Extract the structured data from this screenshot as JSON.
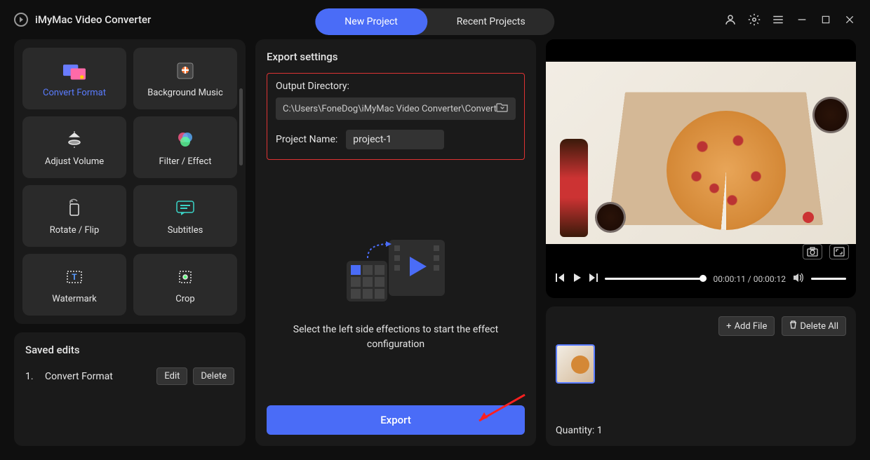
{
  "app": {
    "title": "iMyMac Video Converter"
  },
  "tabs": {
    "new_project": "New Project",
    "recent_projects": "Recent Projects"
  },
  "tools": {
    "convert_format": "Convert Format",
    "background_music": "Background Music",
    "adjust_volume": "Adjust Volume",
    "filter_effect": "Filter / Effect",
    "rotate_flip": "Rotate / Flip",
    "subtitles": "Subtitles",
    "watermark": "Watermark",
    "crop": "Crop"
  },
  "saved_edits": {
    "title": "Saved edits",
    "items": [
      {
        "index": "1.",
        "name": "Convert Format"
      }
    ],
    "edit_label": "Edit",
    "delete_label": "Delete"
  },
  "export": {
    "title": "Export settings",
    "output_dir_label": "Output Directory:",
    "output_dir_value": "C:\\Users\\FoneDog\\iMyMac Video Converter\\Converted",
    "project_name_label": "Project Name:",
    "project_name_value": "project-1",
    "helper_text": "Select the left side effections to start the effect configuration",
    "export_button": "Export"
  },
  "player": {
    "time_current": "00:00:11",
    "time_total": "00:00:12",
    "time_sep": " / "
  },
  "files": {
    "add_file_label": "Add File",
    "delete_all_label": "Delete All",
    "quantity_label": "Quantity: ",
    "quantity_value": "1"
  }
}
